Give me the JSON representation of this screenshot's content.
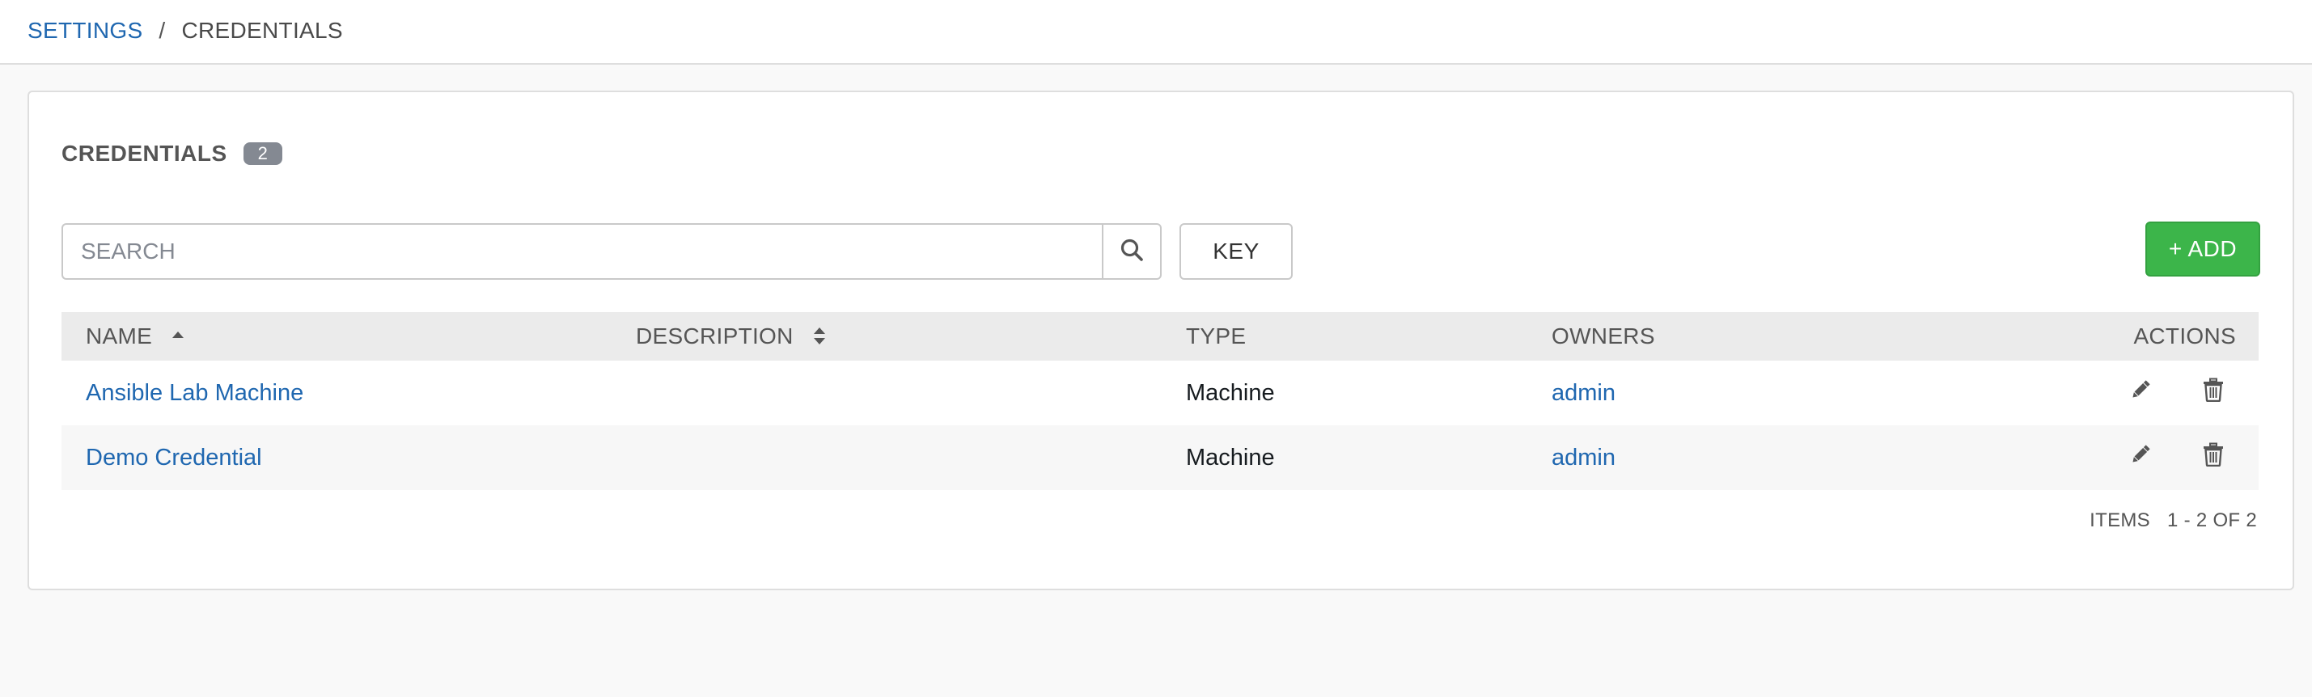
{
  "breadcrumb": {
    "settings": "SETTINGS",
    "separator": "/",
    "current": "CREDENTIALS"
  },
  "panel": {
    "title": "CREDENTIALS",
    "count": "2"
  },
  "search": {
    "placeholder": "SEARCH",
    "value": ""
  },
  "toolbar": {
    "key_label": "KEY",
    "add_label": "+ ADD"
  },
  "table": {
    "columns": {
      "name": "NAME",
      "description": "DESCRIPTION",
      "type": "TYPE",
      "owners": "OWNERS",
      "actions": "ACTIONS"
    },
    "rows": [
      {
        "name": "Ansible Lab Machine",
        "description": "",
        "type": "Machine",
        "owners": "admin"
      },
      {
        "name": "Demo Credential",
        "description": "",
        "type": "Machine",
        "owners": "admin"
      }
    ]
  },
  "pagination": {
    "label": "ITEMS",
    "range": "1 - 2 OF 2"
  },
  "colors": {
    "link": "#1f67b0",
    "add_button": "#3cb54a",
    "badge": "#848992",
    "header_bg": "#ebebeb"
  },
  "icons": {
    "search": "search-icon",
    "sort_asc": "sort-ascending-icon",
    "sort_both": "sort-icon",
    "edit": "pencil-icon",
    "delete": "trash-icon"
  }
}
